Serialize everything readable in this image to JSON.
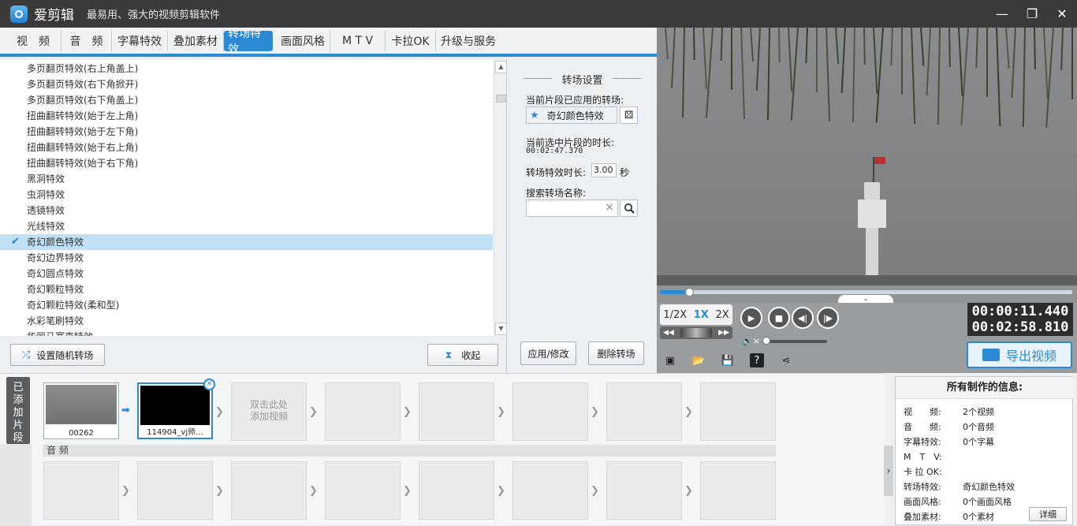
{
  "app": {
    "name": "爱剪辑",
    "slogan": "最易用、强大的视频剪辑软件"
  },
  "window": {
    "min": "—",
    "restore": "❐",
    "close": "✕"
  },
  "tabs": [
    "视　频",
    "音　频",
    "字幕特效",
    "叠加素材",
    "转场特效",
    "画面风格",
    "M T V",
    "卡拉OK",
    "升级与服务"
  ],
  "effects": [
    "多页翻页特效(右上角盖上)",
    "多页翻页特效(右下角掀开)",
    "多页翻页特效(右下角盖上)",
    "扭曲翻转特效(始于左上角)",
    "扭曲翻转特效(始于左下角)",
    "扭曲翻转特效(始于右上角)",
    "扭曲翻转特效(始于右下角)",
    "黑洞特效",
    "虫洞特效",
    "透镜特效",
    "光线特效",
    "奇幻颜色特效",
    "奇幻边界特效",
    "奇幻圆点特效",
    "奇幻颗粒特效",
    "奇幻颗粒特效(柔和型)",
    "水彩笔刷特效",
    "华丽马赛克特效"
  ],
  "selected_effect_index": 11,
  "buttons": {
    "random": "设置随机转场",
    "collapse": "收起",
    "apply": "应用/修改",
    "delete": "删除转场"
  },
  "settings": {
    "title": "转场设置",
    "applied_label": "当前片段已应用的转场:",
    "applied_value": "奇幻颜色特效",
    "duration_label": "当前选中片段的时长:",
    "duration_value": "00:02:47.370",
    "effect_duration_label": "转场特效时长:",
    "effect_duration_value": "3.00",
    "effect_duration_unit": "秒",
    "search_label": "搜索转场名称:",
    "search_value": "",
    "search_clear": "×"
  },
  "player": {
    "speeds": [
      "1/2X",
      "1X",
      "2X"
    ],
    "active_speed": "1X",
    "time_current": "00:00:11.440",
    "time_total": "00:02:58.810",
    "export_label": "导出视频",
    "seek_fraction": 0.07
  },
  "timeline": {
    "side_label": "已添加片段",
    "clips": [
      {
        "name": "00262"
      },
      {
        "name": "114904_vj师..."
      }
    ],
    "placeholder": "双击此处\n添加视频",
    "audio_label": "音 频"
  },
  "info": {
    "title": "所有制作的信息:",
    "rows": [
      {
        "k": "视　　频:",
        "v": "2个视频"
      },
      {
        "k": "音　　频:",
        "v": "0个音频"
      },
      {
        "k": "字幕特效:",
        "v": "0个字幕"
      },
      {
        "k": "M　T　V:",
        "v": ""
      },
      {
        "k": "卡 拉 OK:",
        "v": ""
      },
      {
        "k": "转场特效:",
        "v": "奇幻颜色特效"
      },
      {
        "k": "画面风格:",
        "v": "0个画面风格"
      },
      {
        "k": "叠加素材:",
        "v": "0个素材"
      }
    ],
    "detail": "详细"
  }
}
